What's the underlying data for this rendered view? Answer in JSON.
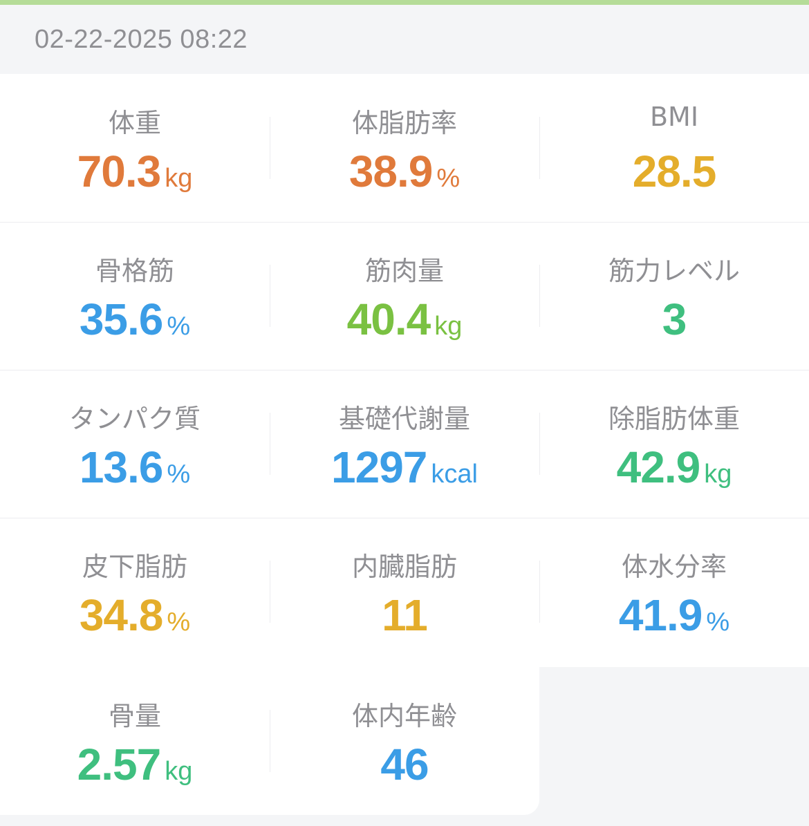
{
  "header": {
    "timestamp": "02-22-2025 08:22"
  },
  "colors": {
    "orange": "#e07a3b",
    "yellow": "#e4ad2b",
    "blue": "#3b9de6",
    "green": "#7ac142",
    "teal": "#3fbf7f",
    "label": "#8f8f93",
    "accent_bar": "#b5dc98"
  },
  "metrics": [
    {
      "label": "体重",
      "value": "70.3",
      "unit": "kg",
      "color": "#e07a3b"
    },
    {
      "label": "体脂肪率",
      "value": "38.9",
      "unit": "%",
      "color": "#e07a3b"
    },
    {
      "label": "BMI",
      "value": "28.5",
      "unit": "",
      "color": "#e4ad2b"
    },
    {
      "label": "骨格筋",
      "value": "35.6",
      "unit": "%",
      "color": "#3b9de6"
    },
    {
      "label": "筋肉量",
      "value": "40.4",
      "unit": "kg",
      "color": "#7ac142"
    },
    {
      "label": "筋力レベル",
      "value": "3",
      "unit": "",
      "color": "#3fbf7f"
    },
    {
      "label": "タンパク質",
      "value": "13.6",
      "unit": "%",
      "color": "#3b9de6"
    },
    {
      "label": "基礎代謝量",
      "value": "1297",
      "unit": "kcal",
      "color": "#3b9de6"
    },
    {
      "label": "除脂肪体重",
      "value": "42.9",
      "unit": "kg",
      "color": "#3fbf7f"
    },
    {
      "label": "皮下脂肪",
      "value": "34.8",
      "unit": "%",
      "color": "#e4ad2b"
    },
    {
      "label": "内臓脂肪",
      "value": "11",
      "unit": "",
      "color": "#e4ad2b"
    },
    {
      "label": "体水分率",
      "value": "41.9",
      "unit": "%",
      "color": "#3b9de6"
    },
    {
      "label": "骨量",
      "value": "2.57",
      "unit": "kg",
      "color": "#3fbf7f"
    },
    {
      "label": "体内年齢",
      "value": "46",
      "unit": "",
      "color": "#3b9de6"
    }
  ]
}
